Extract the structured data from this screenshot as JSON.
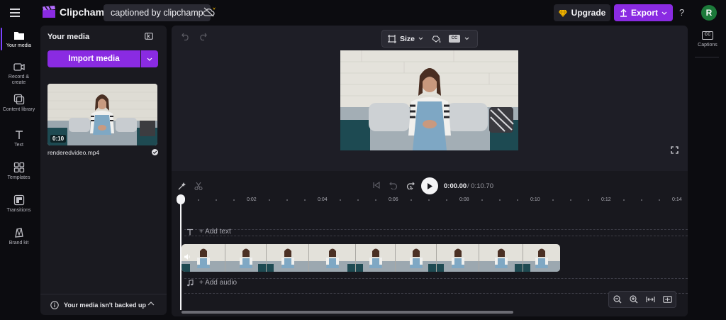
{
  "app": {
    "name": "Clipchamp",
    "project_name": "captioned by clipchamp"
  },
  "header": {
    "upgrade_label": "Upgrade",
    "export_label": "Export",
    "help_label": "?",
    "avatar_initial": "R"
  },
  "nav": {
    "items": [
      {
        "label": "Your media",
        "icon": "folder-icon",
        "active": true
      },
      {
        "label": "Record & create",
        "icon": "video-camera-icon"
      },
      {
        "label": "Content library",
        "icon": "content-library-icon"
      },
      {
        "label": "Text",
        "icon": "text-icon"
      },
      {
        "label": "Templates",
        "icon": "templates-icon"
      },
      {
        "label": "Transitions",
        "icon": "transitions-icon"
      },
      {
        "label": "Brand kit",
        "icon": "brand-kit-icon"
      }
    ]
  },
  "media": {
    "title": "Your media",
    "import_label": "Import media",
    "item": {
      "duration": "0:10",
      "filename": "renderedvideo.mp4"
    },
    "backup_text": "Your media isn't backed up"
  },
  "preview": {
    "size_label": "Size",
    "cc_label": "CC"
  },
  "timeline": {
    "current_time": "0:00.00",
    "total_time": "/ 0:10.70",
    "ticks": [
      "0:02",
      "0:04",
      "0:06",
      "0:08",
      "0:10",
      "0:12",
      "0:14"
    ],
    "add_text_label": "+ Add text",
    "add_audio_label": "+ Add audio"
  },
  "right_panel": {
    "captions_label": "Captions",
    "captions_icon_text": "CC"
  },
  "colors": {
    "accent": "#8a2be2",
    "background": "#0c0c10",
    "panel": "#1a1a20",
    "upgrade_gem": "#f5b800"
  }
}
